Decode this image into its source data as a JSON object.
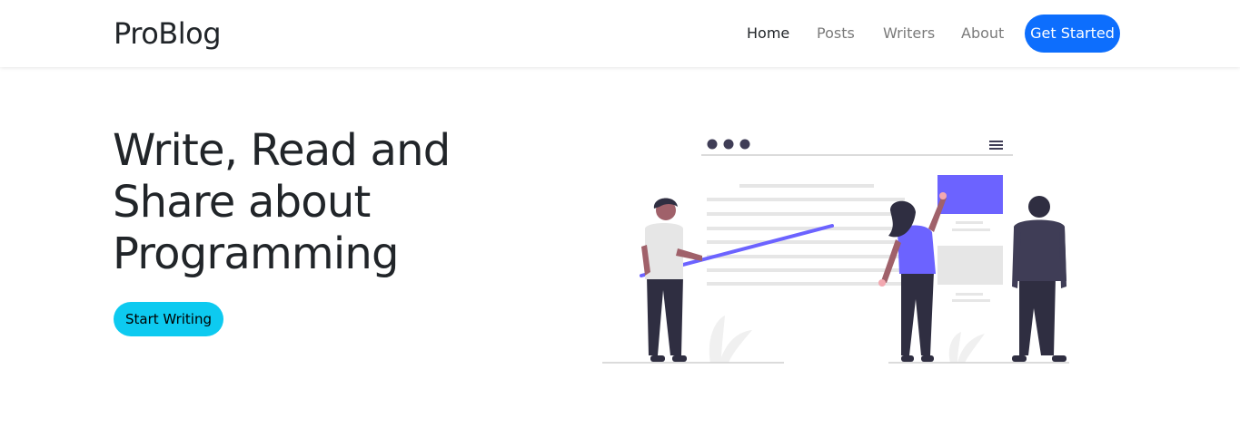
{
  "brand": {
    "name": "ProBlog"
  },
  "nav": {
    "home": "Home",
    "posts": "Posts",
    "writers": "Writers",
    "about": "About",
    "cta": "Get Started"
  },
  "hero": {
    "title_lines": [
      "Write, Read and",
      "Share about",
      "Programming"
    ],
    "button": "Start Writing"
  },
  "colors": {
    "primary": "#0d6efd",
    "info": "#0dcaf0",
    "accent": "#6c63ff",
    "dark": "#2f2e41"
  },
  "illustration": {
    "icon": "team-presentation-illustration"
  }
}
